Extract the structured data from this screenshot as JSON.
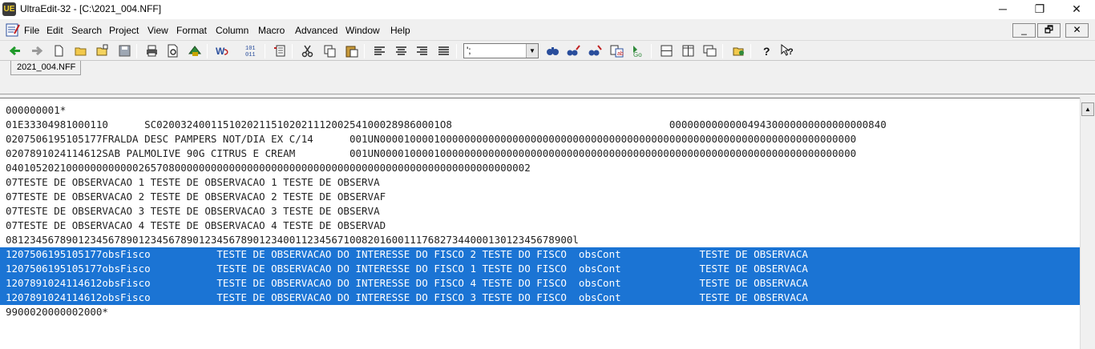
{
  "window": {
    "title": "UltraEdit-32 - [C:\\2021_004.NFF]",
    "app_icon_text": "UE",
    "minimize": "─",
    "restore": "❐",
    "close": "✕"
  },
  "menu": {
    "items": [
      "File",
      "Edit",
      "Search",
      "Project",
      "View",
      "Format",
      "Column",
      "Macro",
      "Advanced",
      "Window",
      "Help"
    ],
    "mdi_minimize": "_",
    "mdi_restore": "🗗",
    "mdi_close": "✕"
  },
  "toolbar": {
    "combo_value": "';"
  },
  "tabs": [
    "2021_004.NFF"
  ],
  "editor": {
    "lines": [
      "000000001*",
      "01E33304981000110      SC02003240011510202115102021112002541000289860001O8                                    000000000000049430000000000000000840",
      "0207506195105177FRALDA DESC PAMPERS NOT/DIA EX C/14      001UN0000100001000000000000000000000000000000000000000000000000000000000000000000000",
      "0207891024114612SAB PALMOLIVE 90G CITRUS E CREAM         001UN0000100001000000000000000000000000000000000000000000000000000000000000000000000",
      "040105202100000000000026570800000000000000000000000000000000000000000000000000000000002",
      "07TESTE DE OBSERVACAO 1 TESTE DE OBSERVACAO 1 TESTE DE OBSERVA",
      "07TESTE DE OBSERVACAO 2 TESTE DE OBSERVACAO 2 TESTE DE OBSERVAF",
      "07TESTE DE OBSERVACAO 3 TESTE DE OBSERVACAO 3 TESTE DE OBSERVA",
      "07TESTE DE OBSERVACAO 4 TESTE DE OBSERVACAO 4 TESTE DE OBSERVAD",
      "0812345678901234567890123456789012345678901234001123456710082016001117682734400013012345678900l",
      "1207506195105177obsFisco           TESTE DE OBSERVACAO DO INTERESSE DO FISCO 2 TESTE DO FISCO  obsCont             TESTE DE OBSERVACA",
      "1207506195105177obsFisco           TESTE DE OBSERVACAO DO INTERESSE DO FISCO 1 TESTE DO FISCO  obsCont             TESTE DE OBSERVACA",
      "1207891024114612obsFisco           TESTE DE OBSERVACAO DO INTERESSE DO FISCO 4 TESTE DO FISCO  obsCont             TESTE DE OBSERVACA",
      "1207891024114612obsFisco           TESTE DE OBSERVACAO DO INTERESSE DO FISCO 3 TESTE DO FISCO  obsCont             TESTE DE OBSERVACA",
      "9900020000002000*"
    ],
    "selected_lines": [
      10,
      11,
      12,
      13
    ]
  },
  "colors": {
    "selection": "#1b74d4",
    "background": "#f0f0f0"
  }
}
